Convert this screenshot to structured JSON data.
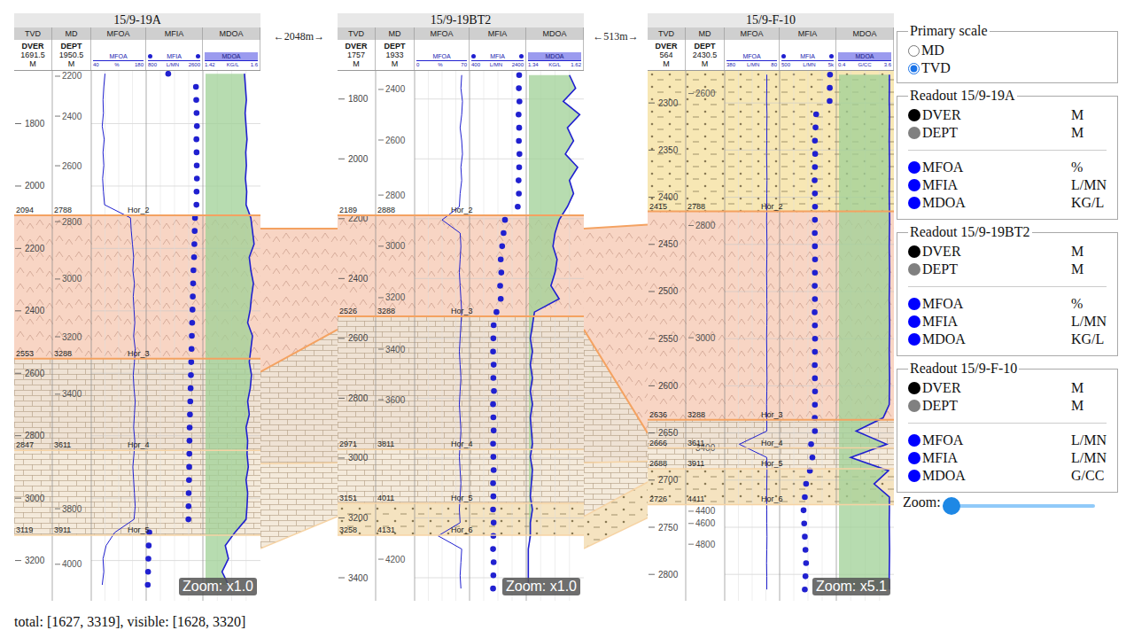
{
  "columns": [
    "TVD",
    "MD",
    "MFOA",
    "MFIA",
    "MDOA"
  ],
  "wells": [
    {
      "title": "15/9-19A",
      "zoom": "Zoom: x1.0",
      "tvd_header": {
        "label": "DVER",
        "value": "1691.5",
        "unit": "M"
      },
      "md_header": {
        "label": "DEPT",
        "value": "1950.5",
        "unit": "M"
      },
      "depth_range": [
        1631,
        3329
      ],
      "top_zone": {
        "color": "#ffffff",
        "pattern": "none"
      },
      "tvd_ticks": [
        "1800",
        "2000",
        "2200",
        "2400",
        "2600",
        "2800",
        "3000",
        "3200"
      ],
      "md_ticks": [
        {
          "label": "2200",
          "tvd": 1648
        },
        {
          "label": "2400",
          "tvd": 1776
        },
        {
          "label": "2600",
          "tvd": 1935
        },
        {
          "label": "2800",
          "tvd": 2114
        },
        {
          "label": "3000",
          "tvd": 2298
        },
        {
          "label": "3200",
          "tvd": 2483
        },
        {
          "label": "3400",
          "tvd": 2667
        },
        {
          "label": "3800",
          "tvd": 3034
        },
        {
          "label": "4000",
          "tvd": 3212
        }
      ],
      "horizons": [
        {
          "name": "Hor_2",
          "tvd": "2094",
          "md": "2788"
        },
        {
          "name": "Hor_3",
          "tvd": "2553",
          "md": "3288"
        },
        {
          "name": "Hor_4",
          "tvd": "2847",
          "md": "3611"
        },
        {
          "name": "Hor_5",
          "tvd": "3119",
          "md": "3911"
        }
      ],
      "sample_start": 1640,
      "sample_step": 42,
      "tracks": [
        {
          "name": "MFOA",
          "kind": "line",
          "min": "40",
          "unit": "%",
          "max": "180",
          "scale": [
            40,
            180
          ],
          "values": [
            75,
            72,
            70,
            71,
            68,
            73,
            70,
            72,
            69,
            71,
            74,
            140,
            142,
            145,
            148,
            146,
            150,
            147,
            149,
            151,
            148,
            152,
            150,
            147,
            149,
            152,
            150,
            148,
            151,
            149,
            146,
            148,
            150,
            152,
            149,
            100,
            78,
            70,
            72,
            68
          ]
        },
        {
          "name": "MFIA",
          "kind": "dots",
          "min": "800",
          "unit": "L/MN",
          "max": "2600",
          "scale": [
            800,
            2600
          ],
          "values": [
            1500,
            2380,
            2390,
            2400,
            2410,
            2395,
            2400,
            2405,
            2410,
            2400,
            2395,
            2350,
            2340,
            2330,
            2320,
            2300,
            2290,
            2280,
            2270,
            2260,
            2250,
            2240,
            2230,
            2220,
            2210,
            2200,
            2190,
            2180,
            2175,
            2170,
            2165,
            2160,
            2150,
            2145,
            2140,
            900,
            880,
            870,
            860,
            850
          ]
        },
        {
          "name": "MDOA",
          "kind": "fill",
          "min": "1.42",
          "unit": "KG/L",
          "max": "1.6",
          "scale": [
            1.42,
            1.6
          ],
          "values": [
            1.55,
            1.553,
            1.556,
            1.552,
            1.555,
            1.558,
            1.554,
            1.556,
            1.553,
            1.557,
            1.555,
            1.57,
            1.575,
            1.58,
            1.565,
            1.57,
            1.578,
            1.572,
            1.568,
            1.56,
            1.575,
            1.57,
            1.565,
            1.572,
            1.568,
            1.56,
            1.565,
            1.555,
            1.56,
            1.558,
            1.562,
            1.555,
            1.56,
            1.558,
            1.555,
            1.52,
            1.49,
            1.5,
            1.48,
            1.5
          ]
        }
      ]
    },
    {
      "title": "15/9-19BT2",
      "zoom": "Zoom: x1.0",
      "tvd_header": {
        "label": "DVER",
        "value": "1757",
        "unit": "M"
      },
      "md_header": {
        "label": "DEPT",
        "value": "1933",
        "unit": "M"
      },
      "depth_range": [
        1706,
        3477
      ],
      "top_zone": {
        "color": "#ffffff",
        "pattern": "none"
      },
      "tvd_ticks": [
        "1800",
        "2000",
        "2200",
        "2400",
        "2600",
        "2800",
        "3000",
        "3200",
        "3400"
      ],
      "md_ticks": [
        {
          "label": "2400",
          "tvd": 1768
        },
        {
          "label": "2600",
          "tvd": 1937
        },
        {
          "label": "2800",
          "tvd": 2121
        },
        {
          "label": "3000",
          "tvd": 2292
        },
        {
          "label": "3200",
          "tvd": 2464
        },
        {
          "label": "3400",
          "tvd": 2636
        },
        {
          "label": "3600",
          "tvd": 2805
        },
        {
          "label": "4200",
          "tvd": 3338
        }
      ],
      "horizons": [
        {
          "name": "Hor_2",
          "tvd": "2189",
          "md": "2888"
        },
        {
          "name": "Hor_3",
          "tvd": "2526",
          "md": "3288"
        },
        {
          "name": "Hor_4",
          "tvd": "2971",
          "md": "3811"
        },
        {
          "name": "Hor_5",
          "tvd": "3151",
          "md": "4011"
        },
        {
          "name": "Hor_6",
          "tvd": "3258",
          "md": "4131"
        }
      ],
      "sample_start": 1720,
      "sample_step": 44,
      "tracks": [
        {
          "name": "MFOA",
          "kind": "line",
          "min": "0",
          "unit": "%",
          "max": "70",
          "scale": [
            0,
            70
          ],
          "values": [
            60,
            59,
            61,
            60,
            58,
            60,
            61,
            59,
            60,
            58,
            57,
            35,
            58,
            59,
            58,
            57,
            58,
            59,
            60,
            59,
            58,
            57,
            58,
            59,
            58,
            57,
            58,
            59,
            58,
            57,
            58,
            59,
            58,
            57,
            58,
            30,
            60,
            59,
            58,
            59
          ]
        },
        {
          "name": "MFIA",
          "kind": "dots",
          "min": "400",
          "unit": "L/MN",
          "max": "2400",
          "scale": [
            400,
            2400
          ],
          "values": [
            2150,
            2140,
            2160,
            2130,
            2150,
            2140,
            2160,
            2150,
            2130,
            2140,
            2100,
            1650,
            1600,
            1550,
            1500,
            1520,
            1480,
            1500,
            1350,
            1250,
            1240,
            1230,
            1250,
            1240,
            1260,
            1230,
            1240,
            1250,
            1230,
            1240,
            1250,
            1230,
            1240,
            1230,
            1250,
            1240,
            1230,
            1250,
            1240,
            1230
          ]
        },
        {
          "name": "MDOA",
          "kind": "fill",
          "min": "1.34",
          "unit": "KG/L",
          "max": "1.62",
          "scale": [
            1.34,
            1.62
          ],
          "values": [
            1.55,
            1.58,
            1.52,
            1.6,
            1.54,
            1.57,
            1.53,
            1.59,
            1.55,
            1.57,
            1.54,
            1.5,
            1.48,
            1.47,
            1.49,
            1.48,
            1.46,
            1.5,
            1.38,
            1.37,
            1.36,
            1.37,
            1.36,
            1.37,
            1.36,
            1.37,
            1.36,
            1.365,
            1.37,
            1.36,
            1.37,
            1.365,
            1.36,
            1.37,
            1.36,
            1.36,
            1.35,
            1.35,
            1.35,
            1.35
          ]
        }
      ]
    },
    {
      "title": "15/9-F-10",
      "zoom": "Zoom: x5.1",
      "tvd_header": {
        "label": "DVER",
        "value": "564",
        "unit": "M"
      },
      "md_header": {
        "label": "DEPT",
        "value": "2430.5",
        "unit": "M"
      },
      "depth_range": [
        2266,
        2828
      ],
      "top_zone": {
        "color": "#f7e7b4",
        "pattern": "dots"
      },
      "tvd_ticks": [
        "2300",
        "2350",
        "2400",
        "2450",
        "2500",
        "2550",
        "2600",
        "2650",
        "2700",
        "2750",
        "2800"
      ],
      "md_ticks": [
        {
          "label": "2600",
          "tvd": 2290
        },
        {
          "label": "2800",
          "tvd": 2430
        },
        {
          "label": "3000",
          "tvd": 2549
        },
        {
          "label": "3400",
          "tvd": 2666
        },
        {
          "label": "4400",
          "tvd": 2733
        },
        {
          "label": "4600",
          "tvd": 2746
        },
        {
          "label": "4800",
          "tvd": 2768
        }
      ],
      "horizons": [
        {
          "name": "Hor_2",
          "tvd": "2415",
          "md": "2788"
        },
        {
          "name": "Hor_3",
          "tvd": "2636",
          "md": "3288"
        },
        {
          "name": "Hor_4",
          "tvd": "2666",
          "md": "3611"
        },
        {
          "name": "Hor_5",
          "tvd": "2688",
          "md": "3911"
        },
        {
          "name": "Hor_6",
          "tvd": "2726",
          "md": "4411"
        }
      ],
      "sample_start": 2270,
      "sample_step": 14,
      "tracks": [
        {
          "name": "MFOA",
          "kind": "line",
          "min": "380",
          "unit": "L/MN",
          "max": "80",
          "scale": [
            380,
            80
          ],
          "values": [
            150,
            150,
            151,
            149,
            150,
            150,
            151,
            150,
            149,
            150,
            150,
            151,
            150,
            149,
            150,
            151,
            150,
            150,
            149,
            150,
            151,
            150,
            150,
            149,
            150,
            151,
            150,
            150,
            300,
            150,
            149,
            150,
            151,
            150,
            150,
            149,
            150,
            151,
            150,
            150
          ]
        },
        {
          "name": "MFIA",
          "kind": "dots",
          "min": "500",
          "unit": "L/MN",
          "max": "5k",
          "scale": [
            500,
            5000
          ],
          "values": [
            4500,
            4480,
            4470,
            3400,
            3350,
            3300,
            3320,
            3300,
            3280,
            3300,
            3310,
            3300,
            3290,
            3300,
            3310,
            3300,
            3290,
            3300,
            3280,
            3300,
            3310,
            3300,
            3290,
            3300,
            3310,
            3300,
            3290,
            3300,
            3000,
            3100,
            2900,
            2600,
            2500,
            2400,
            2450,
            2500,
            2550,
            2600,
            2550,
            2500
          ]
        },
        {
          "name": "MDOA",
          "kind": "fill",
          "min": "0.4",
          "unit": "G/CC",
          "max": "3.6",
          "scale": [
            0.4,
            3.6
          ],
          "values": [
            3.35,
            3.35,
            3.34,
            3.36,
            3.35,
            3.34,
            3.35,
            3.36,
            3.35,
            3.34,
            3.35,
            3.36,
            3.35,
            3.34,
            3.35,
            3.36,
            3.35,
            3.34,
            3.35,
            3.36,
            3.35,
            3.34,
            3.35,
            3.36,
            3.35,
            3.34,
            3.0,
            1.5,
            3.2,
            1.2,
            3.3,
            2.5,
            3.35,
            3.35,
            3.34,
            3.35,
            3.36,
            3.35,
            3.34,
            3.35
          ]
        }
      ]
    }
  ],
  "gaps": [
    {
      "label": "←2048m→"
    },
    {
      "label": "←513m→"
    }
  ],
  "zones": [
    {
      "name": "Hor_2",
      "color": "#f8d5c4",
      "pattern": "caret",
      "line_color": "#f4a261",
      "strong": true
    },
    {
      "name": "Hor_3",
      "color": "#efe2d4",
      "pattern": "brick",
      "line_color": "#f4a261",
      "strong": true
    },
    {
      "name": "Hor_4",
      "color": "#f4eadb",
      "pattern": "brick",
      "line_color": "#f6d3a4",
      "strong": false
    },
    {
      "name": "Hor_5",
      "color": "#f5e3c0",
      "pattern": "dots",
      "line_color": "#f6d3a4",
      "strong": false
    },
    {
      "name": "Hor_6",
      "color": "#ffffff",
      "pattern": "none",
      "line_color": "#f6d3a4",
      "strong": false
    }
  ],
  "primary_scale": {
    "title": "Primary scale",
    "options": [
      {
        "label": "MD",
        "selected": false
      },
      {
        "label": "TVD",
        "selected": true
      }
    ]
  },
  "readouts": [
    {
      "title": "Readout 15/9-19A",
      "depth_items": [
        {
          "name": "DVER",
          "unit": "M",
          "color": "#000000"
        },
        {
          "name": "DEPT",
          "unit": "M",
          "color": "#808080"
        }
      ],
      "curve_items": [
        {
          "name": "MFOA",
          "unit": "%",
          "color": "#0000ff"
        },
        {
          "name": "MFIA",
          "unit": "L/MN",
          "color": "#0000ff"
        },
        {
          "name": "MDOA",
          "unit": "KG/L",
          "color": "#0000ff"
        }
      ]
    },
    {
      "title": "Readout 15/9-19BT2",
      "depth_items": [
        {
          "name": "DVER",
          "unit": "M",
          "color": "#000000"
        },
        {
          "name": "DEPT",
          "unit": "M",
          "color": "#808080"
        }
      ],
      "curve_items": [
        {
          "name": "MFOA",
          "unit": "%",
          "color": "#0000ff"
        },
        {
          "name": "MFIA",
          "unit": "L/MN",
          "color": "#0000ff"
        },
        {
          "name": "MDOA",
          "unit": "KG/L",
          "color": "#0000ff"
        }
      ]
    },
    {
      "title": "Readout 15/9-F-10",
      "depth_items": [
        {
          "name": "DVER",
          "unit": "M",
          "color": "#000000"
        },
        {
          "name": "DEPT",
          "unit": "M",
          "color": "#808080"
        }
      ],
      "curve_items": [
        {
          "name": "MFOA",
          "unit": "L/MN",
          "color": "#0000ff"
        },
        {
          "name": "MFIA",
          "unit": "L/MN",
          "color": "#0000ff"
        },
        {
          "name": "MDOA",
          "unit": "G/CC",
          "color": "#0000ff"
        }
      ]
    }
  ],
  "zoom": {
    "label": "Zoom:",
    "level": 0
  },
  "footer": "total: [1627, 3319], visible: [1628, 3320]"
}
